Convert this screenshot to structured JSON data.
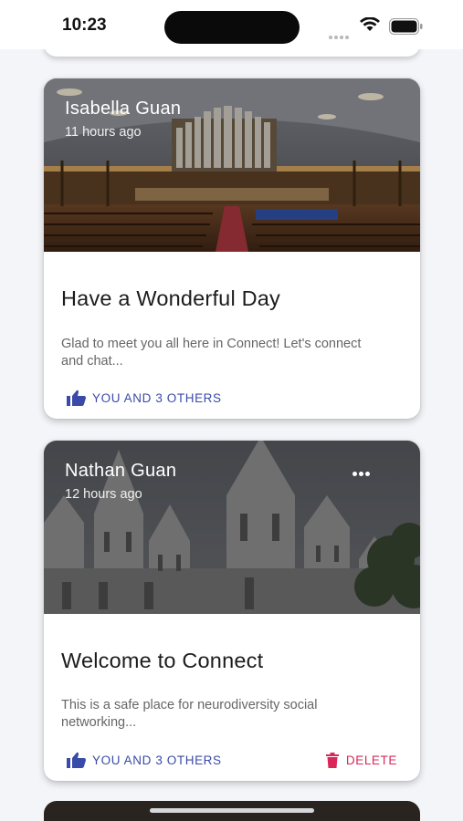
{
  "status": {
    "time": "10:23"
  },
  "posts": [
    {
      "author": "Isabella Guan",
      "posted": "11 hours ago",
      "title": "Have a Wonderful Day",
      "body": "Glad to meet you all here in Connect! Let's connect and chat...",
      "likes_label": "YOU AND 3 OTHERS"
    },
    {
      "author": "Nathan Guan",
      "posted": "12 hours ago",
      "title": "Welcome to Connect",
      "body": "This is a safe place for neurodiversity social networking...",
      "likes_label": "YOU AND 3 OTHERS",
      "delete_label": "DELETE"
    }
  ],
  "colors": {
    "accent": "#3a4aa8",
    "danger": "#d8285a"
  },
  "icons": [
    "wifi-icon",
    "battery-icon",
    "thumbs-up-icon",
    "more-icon",
    "trash-icon"
  ]
}
